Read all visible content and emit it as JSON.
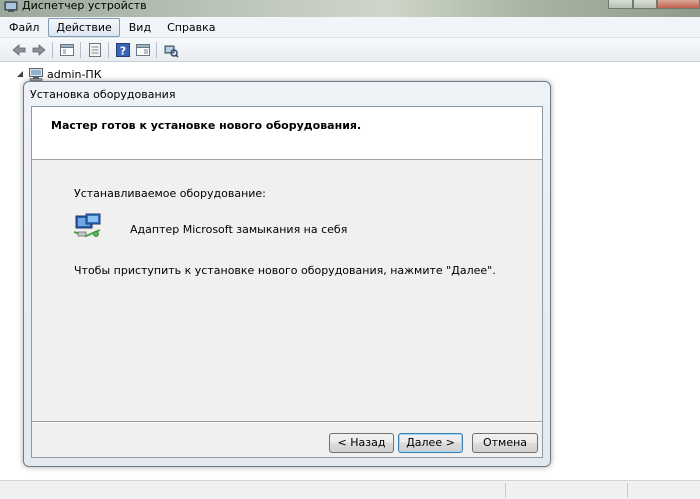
{
  "window": {
    "title": "Диспетчер устройств"
  },
  "menu": {
    "items": [
      "Файл",
      "Действие",
      "Вид",
      "Справка"
    ],
    "active_index": 1
  },
  "toolbar": {
    "icons": [
      "back-icon",
      "forward-icon",
      "console-tree-icon",
      "properties-icon",
      "help-icon",
      "show-hide-icon",
      "scan-hardware-icon"
    ]
  },
  "tree": {
    "root_label": "admin-ПК"
  },
  "dialog": {
    "title": "Установка оборудования",
    "header_title": "Мастер готов к установке нового оборудования.",
    "installing_label": "Устанавливаемое оборудование:",
    "device_name": "Адаптер Microsoft замыкания на себя",
    "instruction": "Чтобы приступить к установке нового оборудования, нажмите \"Далее\".",
    "buttons": {
      "back": "< Назад",
      "next": "Далее >",
      "cancel": "Отмена"
    }
  },
  "colors": {
    "dialog_border": "#6e7c8a",
    "default_button_border": "#3c7fb1",
    "menu_bg": "#f1f4f8"
  }
}
